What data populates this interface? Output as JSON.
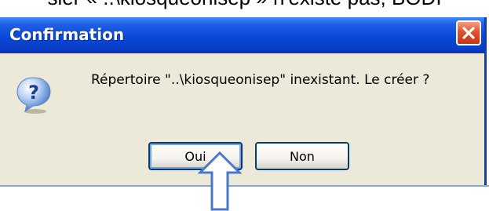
{
  "background": {
    "partial_text": "sier « ..\\kiosqueonisep » n'existe pas, BODI"
  },
  "dialog": {
    "title": "Confirmation",
    "message": "Répertoire \"..\\kiosqueonisep\" inexistant. Le créer ?",
    "icon": "question-icon",
    "buttons": {
      "yes_label": "Oui",
      "no_label": "Non"
    }
  },
  "colors": {
    "titlebar": "#0a48d8",
    "dialog_body": "#ece9d8",
    "close_button": "#e0512f",
    "annotation_arrow": "#4a78c8"
  }
}
